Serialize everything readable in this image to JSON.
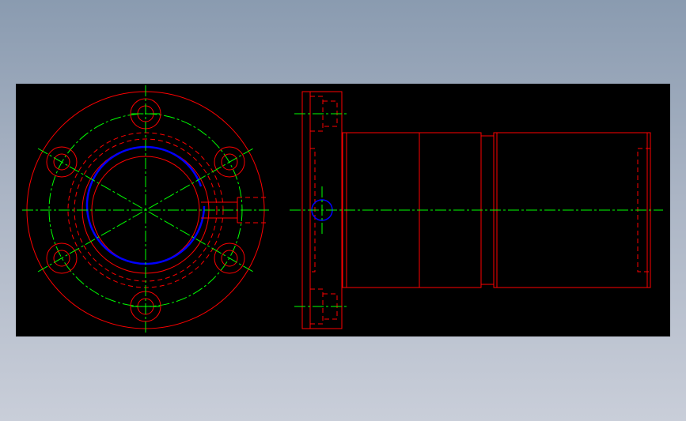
{
  "viewer": {
    "background_gradient": [
      "#8a9bb0",
      "#c9ced9"
    ],
    "canvas_color": "#000000"
  },
  "drawing": {
    "views": [
      "front-view",
      "side-view"
    ],
    "colors": {
      "outline": "#ff0000",
      "centerline": "#00ff00",
      "highlight": "#0000ff"
    },
    "front_view": {
      "bolt_hole_count": 6
    }
  }
}
